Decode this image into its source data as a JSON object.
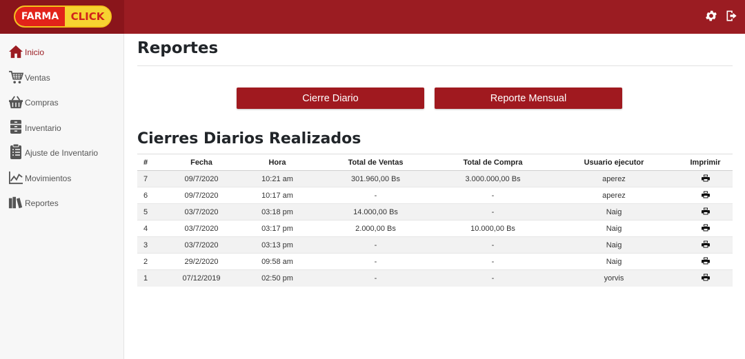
{
  "brand": {
    "part1": "FARMA",
    "part2": "CLICK"
  },
  "topbar": {
    "icons": [
      "gear-icon",
      "logout-icon"
    ]
  },
  "sidebar": {
    "items": [
      {
        "label": "Inicio",
        "icon": "home-icon",
        "active": true
      },
      {
        "label": "Ventas",
        "icon": "cart-icon"
      },
      {
        "label": "Compras",
        "icon": "basket-icon"
      },
      {
        "label": "Inventario",
        "icon": "archive-icon"
      },
      {
        "label": "Ajuste de Inventario",
        "icon": "clipboard-icon"
      },
      {
        "label": "Movimientos",
        "icon": "line-chart-icon"
      },
      {
        "label": "Reportes",
        "icon": "books-icon"
      }
    ]
  },
  "main": {
    "title": "Reportes",
    "buttons": {
      "daily": "Cierre Diario",
      "monthly": "Reporte Mensual"
    },
    "section_title": "Cierres Diarios Realizados",
    "table": {
      "headers": [
        "#",
        "Fecha",
        "Hora",
        "Total de Ventas",
        "Total de Compra",
        "Usuario ejecutor",
        "Imprimir"
      ],
      "rows": [
        [
          "7",
          "09/7/2020",
          "10:21 am",
          "301.960,00 Bs",
          "3.000.000,00 Bs",
          "aperez"
        ],
        [
          "6",
          "09/7/2020",
          "10:17 am",
          "-",
          "-",
          "aperez"
        ],
        [
          "5",
          "03/7/2020",
          "03:18 pm",
          "14.000,00 Bs",
          "-",
          "Naig"
        ],
        [
          "4",
          "03/7/2020",
          "03:17 pm",
          "2.000,00 Bs",
          "10.000,00 Bs",
          "Naig"
        ],
        [
          "3",
          "03/7/2020",
          "03:13 pm",
          "-",
          "-",
          "Naig"
        ],
        [
          "2",
          "29/2/2020",
          "09:58 am",
          "-",
          "-",
          "Naig"
        ],
        [
          "1",
          "07/12/2019",
          "02:50 pm",
          "-",
          "-",
          "yorvis"
        ]
      ],
      "row_action_icon": "print-icon"
    }
  },
  "colors": {
    "primary": "#9b1c22",
    "button": "#a0191f",
    "stripe": "#f2f2f2",
    "sidebar": "#f7f7f7"
  }
}
